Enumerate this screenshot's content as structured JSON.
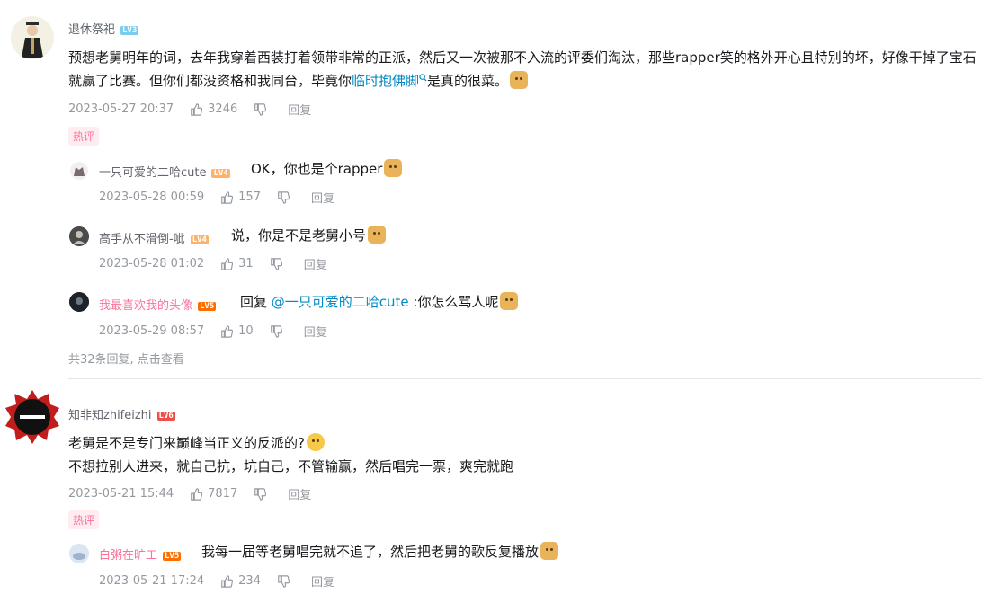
{
  "comments": [
    {
      "user": "退休祭祀",
      "level": "LV3",
      "text": "预想老舅明年的词，去年我穿着西装打着领带非常的正派，然后又一次被那不入流的评委们淘汰，那些rapper笑的格外开心且特别的坏，好像干掉了宝石就赢了比赛。但你们都没资格和我同台，毕竟你",
      "link": "临时抱佛脚",
      "text_after": "是真的很菜。",
      "date": "2023-05-27 20:37",
      "likes": "3246",
      "reply_label": "回复",
      "badge": "热评",
      "replies": [
        {
          "user": "一只可爱的二哈cute",
          "level": "LV4",
          "text": "OK，你也是个rapper",
          "date": "2023-05-28 00:59",
          "likes": "157",
          "reply_label": "回复"
        },
        {
          "user": "高手从不滑倒-呲",
          "level": "LV4",
          "text": "说，你是不是老舅小号",
          "date": "2023-05-28 01:02",
          "likes": "31",
          "reply_label": "回复"
        },
        {
          "user": "我最喜欢我的头像",
          "level": "LV5",
          "prefix": "回复 ",
          "mention": "@一只可爱的二哈cute",
          "text": " :你怎么骂人呢",
          "date": "2023-05-29 08:57",
          "likes": "10",
          "reply_label": "回复"
        }
      ],
      "more": "共32条回复, 点击查看"
    },
    {
      "user": "知非知zhifeizhi",
      "level": "LV6",
      "line1": "老舅是不是专门来巅峰当正义的反派的?",
      "line2": "不想拉别人进来，就自己抗，坑自己，不管输赢，然后唱完一票，爽完就跑",
      "date": "2023-05-21 15:44",
      "likes": "7817",
      "reply_label": "回复",
      "badge": "热评",
      "replies": [
        {
          "user": "白粥在旷工",
          "level": "LV5",
          "text": "我每一届等老舅唱完就不追了，然后把老舅的歌反复播放",
          "date": "2023-05-21 17:24",
          "likes": "234",
          "reply_label": "回复"
        }
      ]
    }
  ]
}
